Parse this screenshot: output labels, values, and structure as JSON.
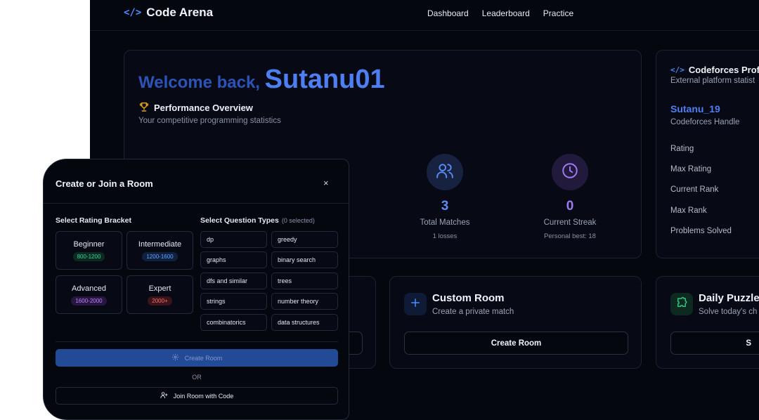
{
  "nav": {
    "brand_icon": "</>",
    "brand_title": "Code Arena",
    "links": [
      "Dashboard",
      "Leaderboard",
      "Practice"
    ]
  },
  "overview": {
    "welcome_prefix": "Welcome back,",
    "username": "Sutanu01",
    "section_title": "Performance Overview",
    "section_subtitle": "Your competitive programming statistics",
    "trophy_icon": "trophy-icon",
    "stats": [
      {
        "icon": "users-icon",
        "value": "3",
        "label": "Total Matches",
        "sub": "1 losses",
        "color": "#5b8cf5",
        "bg": "#16223f"
      },
      {
        "icon": "clock-icon",
        "value": "0",
        "label": "Current Streak",
        "sub": "Personal best: 18",
        "color": "#a07af2",
        "bg": "#221a3d"
      }
    ]
  },
  "codeforces": {
    "icon": "</>",
    "title": "Codeforces Profil",
    "subtitle": "External platform statist",
    "handle": "Sutanu_19",
    "handle_label": "Codeforces Handle",
    "rows": [
      "Rating",
      "Max Rating",
      "Current Rank",
      "Max Rank",
      "Problems Solved"
    ]
  },
  "actions": {
    "custom": {
      "icon": "plus-icon",
      "title": "Custom Room",
      "subtitle": "Create a private match",
      "button": "Create Room",
      "icon_color": "#4a8cff"
    },
    "daily": {
      "icon": "puzzle-icon",
      "title": "Daily Puzzle",
      "subtitle": "Solve today's ch",
      "button": "S",
      "icon_color": "#2ec27e"
    }
  },
  "modal": {
    "title": "Create or Join a Room",
    "close": "×",
    "rating_label": "Select Rating Bracket",
    "question_label": "Select Question Types",
    "selected_count": "(0 selected)",
    "brackets": [
      {
        "name": "Beginner",
        "range": "800-1200",
        "color": "#34d399",
        "bg": "#0d2a20"
      },
      {
        "name": "Intermediate",
        "range": "1200-1600",
        "color": "#60a5fa",
        "bg": "#10213f"
      },
      {
        "name": "Advanced",
        "range": "1600-2000",
        "color": "#c084fc",
        "bg": "#271640"
      },
      {
        "name": "Expert",
        "range": "2000+",
        "color": "#f87171",
        "bg": "#3a1418"
      }
    ],
    "question_types": [
      "dp",
      "greedy",
      "graphs",
      "binary search",
      "dfs and similar",
      "trees",
      "strings",
      "number theory",
      "combinatorics",
      "data structures"
    ],
    "create_button": "Create Room",
    "or_text": "OR",
    "join_button": "Join Room with Code"
  }
}
